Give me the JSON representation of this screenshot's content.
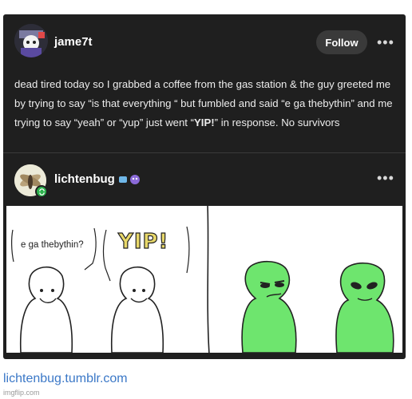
{
  "post1": {
    "username": "jame7t",
    "follow_label": "Follow",
    "more_label": "•••",
    "text_parts": {
      "a": "dead tired today so I grabbed a coffee from the gas station & the guy greeted me by trying to say “is that everything “ but fumbled and said “e ga thebythin” and me trying to say “yeah” or “yup” just went “",
      "b": "YIP!",
      "c": "” in response. No survivors"
    }
  },
  "post2": {
    "username": "lichtenbug",
    "more_label": "•••"
  },
  "comic": {
    "bubble1": "e ga thebythin?",
    "bubble2": "YIP!"
  },
  "footer": {
    "source": "lichtenbug.tumblr.com",
    "watermark": "imgflip.com"
  },
  "colors": {
    "card_bg": "#1f1f1f",
    "alien_green": "#6ee56e",
    "link": "#3b78c7"
  },
  "icons": [
    "avatar-jame7t",
    "avatar-lichtenbug",
    "reblog-icon",
    "more-icon",
    "ghost-badge-icon"
  ]
}
